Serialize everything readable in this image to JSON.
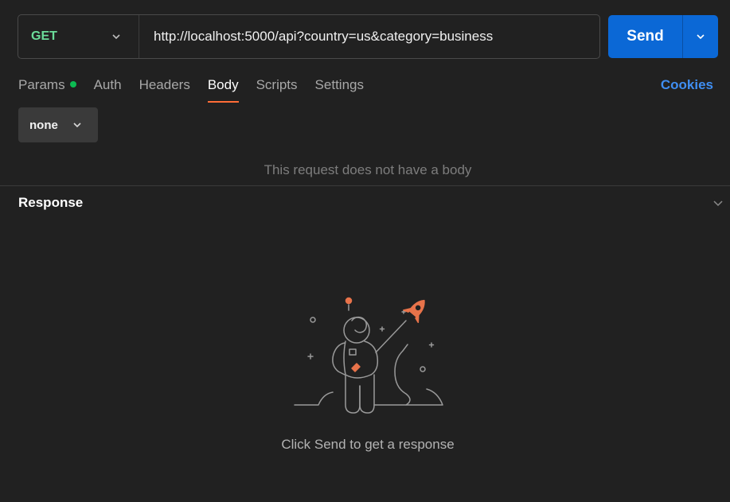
{
  "request": {
    "method": "GET",
    "url": "http://localhost:5000/api?country=us&category=business",
    "send_label": "Send"
  },
  "tabs": [
    {
      "label": "Params",
      "has_indicator": true
    },
    {
      "label": "Auth"
    },
    {
      "label": "Headers"
    },
    {
      "label": "Body",
      "active": true
    },
    {
      "label": "Scripts"
    },
    {
      "label": "Settings"
    }
  ],
  "cookies_label": "Cookies",
  "body": {
    "type_selected": "none",
    "empty_message": "This request does not have a body"
  },
  "response": {
    "title": "Response",
    "empty_message": "Click Send to get a response"
  },
  "colors": {
    "background": "#212121",
    "method_get": "#6bdd9a",
    "send_button": "#0b68d6",
    "accent_tab": "#ff6c37",
    "cookies_link": "#3f8ef2",
    "indicator_dot": "#0cbb52"
  }
}
